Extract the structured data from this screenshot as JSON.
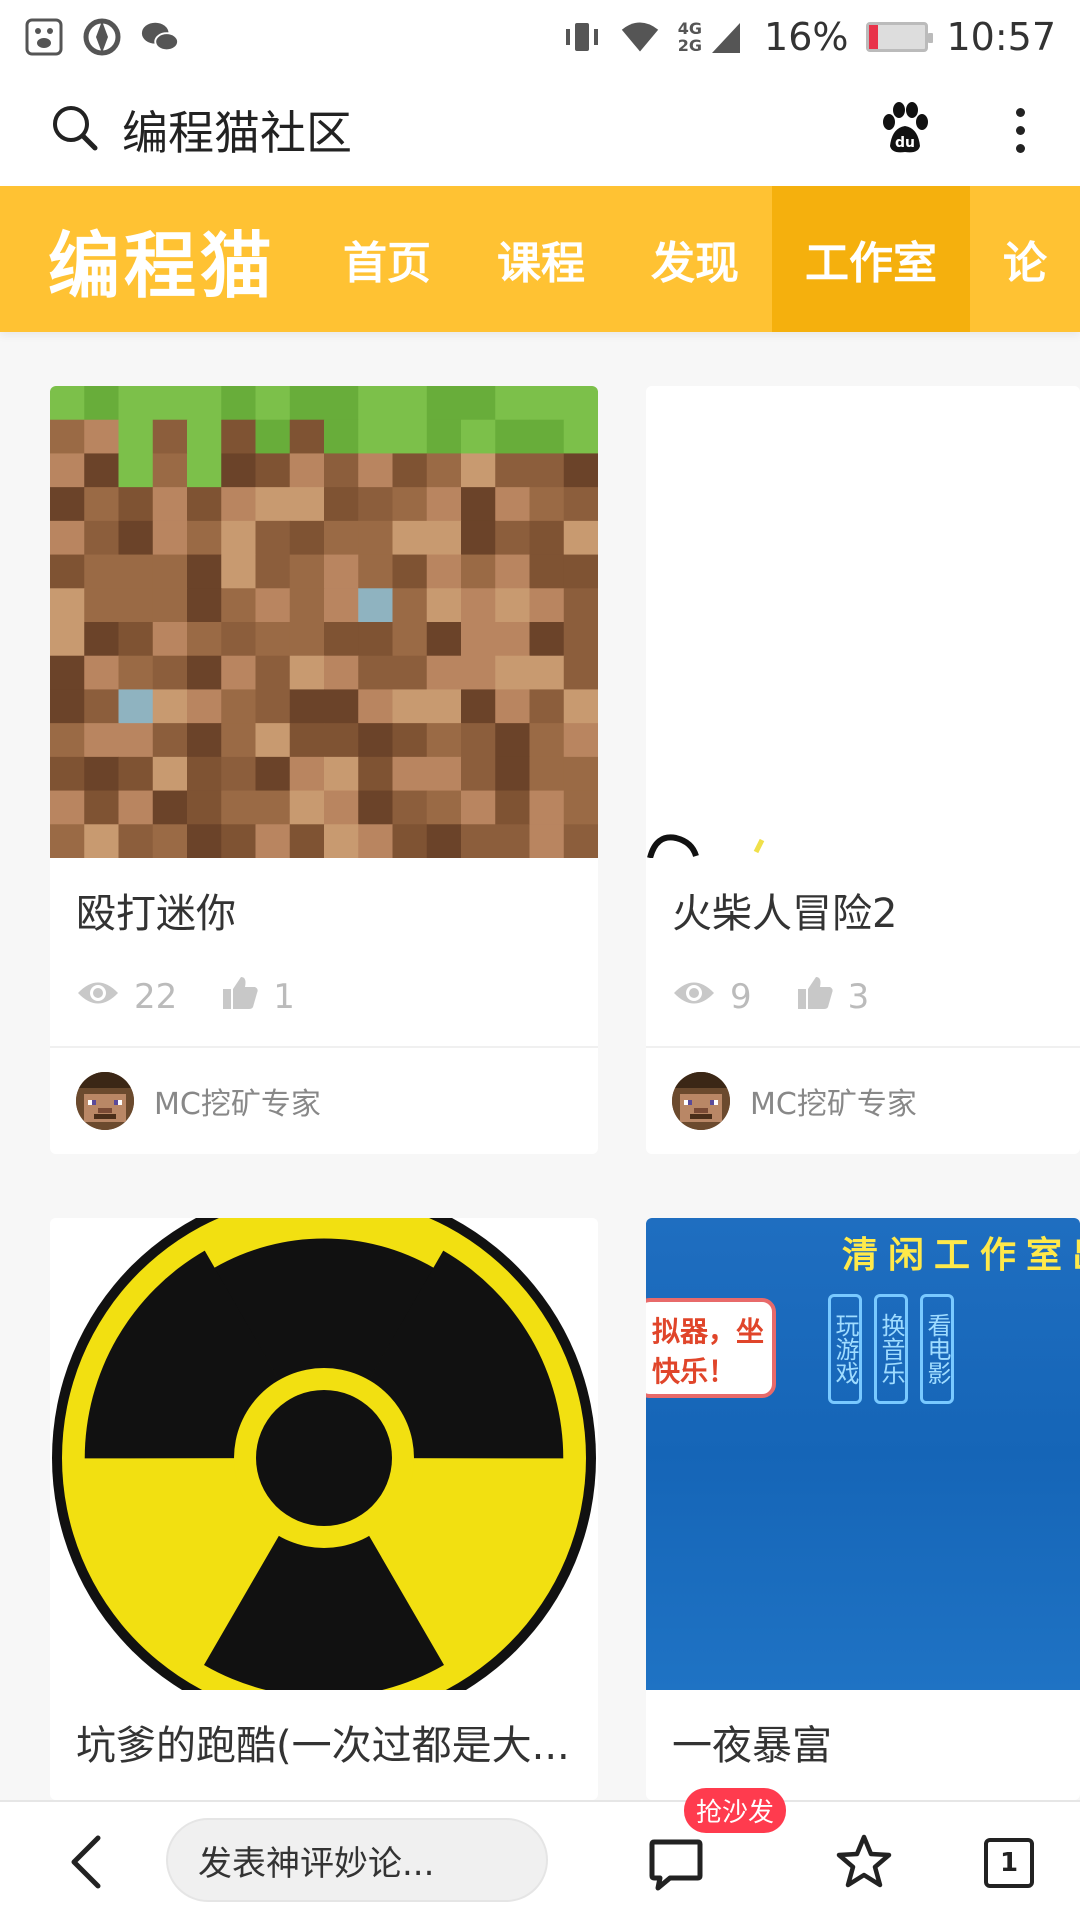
{
  "status_bar": {
    "network": "4G",
    "network2": "2G",
    "battery_percent": "16%",
    "battery_level": 0.16,
    "time": "10:57"
  },
  "browser": {
    "query": "编程猫社区"
  },
  "site": {
    "logo": "编程猫",
    "accent": "#ffc233",
    "nav": [
      {
        "label": "首页"
      },
      {
        "label": "课程"
      },
      {
        "label": "发现"
      },
      {
        "label": "工作室"
      },
      {
        "label": "论"
      }
    ]
  },
  "cards": [
    {
      "title": "殴打迷你",
      "views": "22",
      "likes": "1",
      "author": "MC挖矿专家"
    },
    {
      "title": "火柴人冒险2",
      "views": "9",
      "likes": "3",
      "author": "MC挖矿专家"
    },
    {
      "title": "坑爹的跑酷(一次过都是大...",
      "views": "",
      "likes": "",
      "author": ""
    },
    {
      "title": "一夜暴富",
      "views": "",
      "likes": "",
      "author": ""
    }
  ],
  "thumb4_text": {
    "header": "清闲工作室出",
    "box_line1": "拟器，坐",
    "box_line2": "快乐！",
    "col1": "玩游戏",
    "col2": "换音乐",
    "col3": "看电影"
  },
  "bottom": {
    "comment_placeholder": "发表神评妙论...",
    "sofa_badge": "抢沙发",
    "tab_count": "1"
  }
}
